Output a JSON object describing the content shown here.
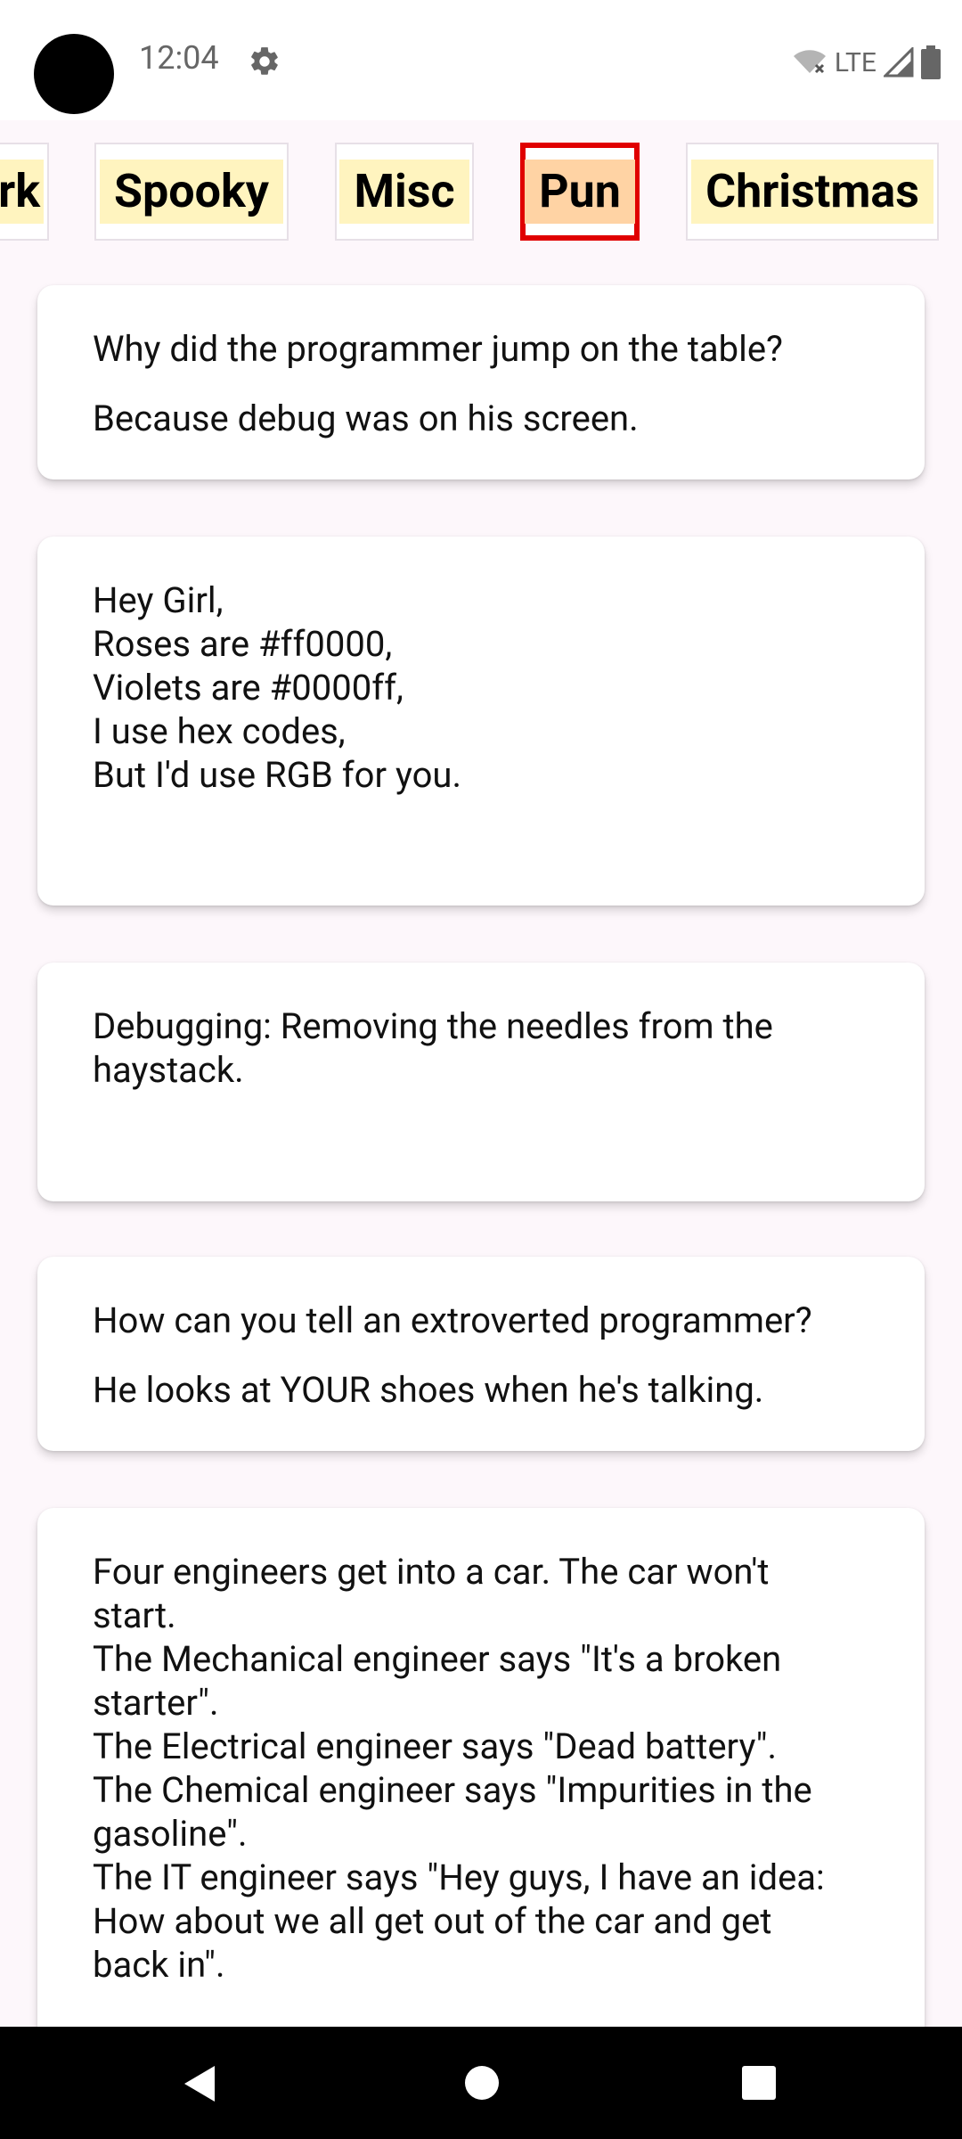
{
  "status_bar": {
    "time": "12:04",
    "network": "LTE"
  },
  "categories": {
    "items": [
      {
        "label": "rk"
      },
      {
        "label": "Spooky"
      },
      {
        "label": "Misc"
      },
      {
        "label": "Pun",
        "selected": true
      },
      {
        "label": "Christmas"
      }
    ]
  },
  "jokes": [
    {
      "setup": "Why did the programmer jump on the table?",
      "delivery": "Because debug was on his screen."
    },
    {
      "lines": [
        "Hey Girl,",
        "Roses are #ff0000,",
        "Violets are #0000ff,",
        "I use hex codes,",
        "But I'd use RGB for you."
      ]
    },
    {
      "lines": [
        "Debugging: Removing the needles from the",
        "haystack."
      ]
    },
    {
      "setup": "How can you tell an extroverted programmer?",
      "delivery": "He looks at YOUR shoes when he's talking."
    },
    {
      "lines": [
        "Four engineers get into a car. The car won't",
        "start.",
        "The Mechanical engineer says \"It's a broken",
        "starter\".",
        "The Electrical engineer says \"Dead battery\".",
        "The Chemical engineer says \"Impurities in the",
        "gasoline\".",
        "The IT engineer says \"Hey guys, I have an idea:",
        "How about we all get out of the car and get",
        "back in\"."
      ]
    }
  ],
  "colors": {
    "chip_bg": "#fff4bf",
    "chip_selected_bg": "#ffd3a4",
    "chip_selected_border": "#e00000",
    "app_bg": "#fdf7fb"
  },
  "icons": {
    "settings": "gear-icon",
    "wifi": "wifi-icon",
    "signal": "signal-icon",
    "battery": "battery-icon",
    "back": "back-icon",
    "home": "home-icon",
    "recents": "recents-icon"
  }
}
